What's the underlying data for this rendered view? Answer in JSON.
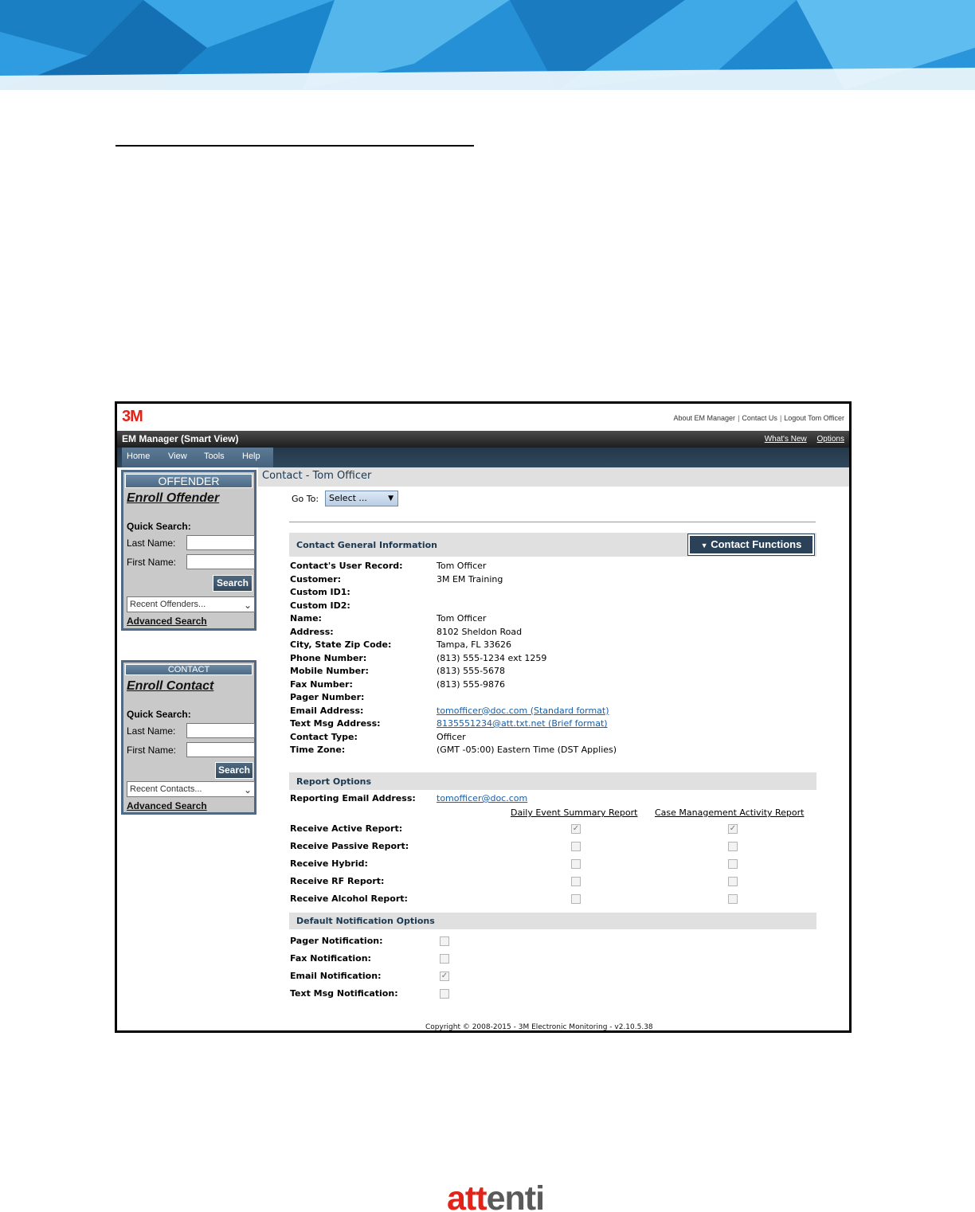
{
  "colors": {
    "brand_red": "#e2231a",
    "nav_blue": "#4e6a84",
    "header_dark": "#1e1e1e",
    "link_blue": "#1a5ea8",
    "banner_blue": "#1f8fd4"
  },
  "app": {
    "logo": "3M",
    "top_links": [
      "About EM Manager",
      "Contact Us",
      "Logout Tom Officer"
    ],
    "title": "EM Manager (Smart View)",
    "title_links": [
      "What's New",
      "Options"
    ],
    "menu": [
      "Home",
      "View",
      "Tools",
      "Help"
    ]
  },
  "sidebar": {
    "offender": {
      "header": "OFFENDER",
      "enroll": "Enroll Offender",
      "quick_search": "Quick Search:",
      "last_name": "Last Name:",
      "first_name": "First Name:",
      "search_button": "Search",
      "recent": "Recent Offenders...",
      "advanced": "Advanced Search"
    },
    "contact": {
      "header": "CONTACT",
      "enroll": "Enroll Contact",
      "quick_search": "Quick Search:",
      "last_name": "Last Name:",
      "first_name": "First Name:",
      "search_button": "Search",
      "recent": "Recent Contacts...",
      "advanced": "Advanced Search"
    }
  },
  "main": {
    "title": "Contact - Tom Officer",
    "goto_label": "Go To:",
    "goto_value": "Select ...",
    "general": {
      "header": "Contact General Information",
      "functions_button": "Contact Functions",
      "fields": [
        {
          "label": "Contact's User Record:",
          "value": "Tom Officer",
          "link": false
        },
        {
          "label": "Customer:",
          "value": "3M EM Training",
          "link": false
        },
        {
          "label": "Custom ID1:",
          "value": "",
          "link": false
        },
        {
          "label": "Custom ID2:",
          "value": "",
          "link": false
        },
        {
          "label": "Name:",
          "value": "Tom Officer",
          "link": false
        },
        {
          "label": "Address:",
          "value": "8102 Sheldon Road",
          "link": false
        },
        {
          "label": "City, State Zip Code:",
          "value": "Tampa, FL 33626",
          "link": false
        },
        {
          "label": "Phone Number:",
          "value": "(813) 555-1234 ext 1259",
          "link": false
        },
        {
          "label": "Mobile Number:",
          "value": "(813) 555-5678",
          "link": false
        },
        {
          "label": "Fax Number:",
          "value": "(813) 555-9876",
          "link": false
        },
        {
          "label": "Pager Number:",
          "value": "",
          "link": false
        },
        {
          "label": "Email Address:",
          "value": "tomofficer@doc.com (Standard format)",
          "link": true
        },
        {
          "label": "Text Msg Address:",
          "value": "8135551234@att.txt.net (Brief format)",
          "link": true
        },
        {
          "label": "Contact Type:",
          "value": "Officer",
          "link": false
        },
        {
          "label": "Time Zone:",
          "value": "(GMT -05:00) Eastern Time (DST Applies)",
          "link": false
        }
      ]
    },
    "reports": {
      "header": "Report Options",
      "email_label": "Reporting Email Address:",
      "email_value": "tomofficer@doc.com",
      "col1": "Daily Event Summary Report",
      "col2": "Case Management Activity Report",
      "rows": [
        {
          "label": "Receive Active Report:",
          "daily": true,
          "case": true
        },
        {
          "label": "Receive Passive Report:",
          "daily": false,
          "case": false
        },
        {
          "label": "Receive Hybrid:",
          "daily": false,
          "case": false
        },
        {
          "label": "Receive RF Report:",
          "daily": false,
          "case": false
        },
        {
          "label": "Receive Alcohol Report:",
          "daily": false,
          "case": false
        }
      ]
    },
    "notifications": {
      "header": "Default Notification Options",
      "rows": [
        {
          "label": "Pager Notification:",
          "checked": false
        },
        {
          "label": "Fax Notification:",
          "checked": false
        },
        {
          "label": "Email Notification:",
          "checked": true
        },
        {
          "label": "Text Msg Notification:",
          "checked": false
        }
      ]
    },
    "footer": "Copyright © 2008-2015 - 3M Electronic Monitoring - v2.10.5.38"
  },
  "document": {
    "brand_left": "att",
    "brand_right": "enti"
  }
}
